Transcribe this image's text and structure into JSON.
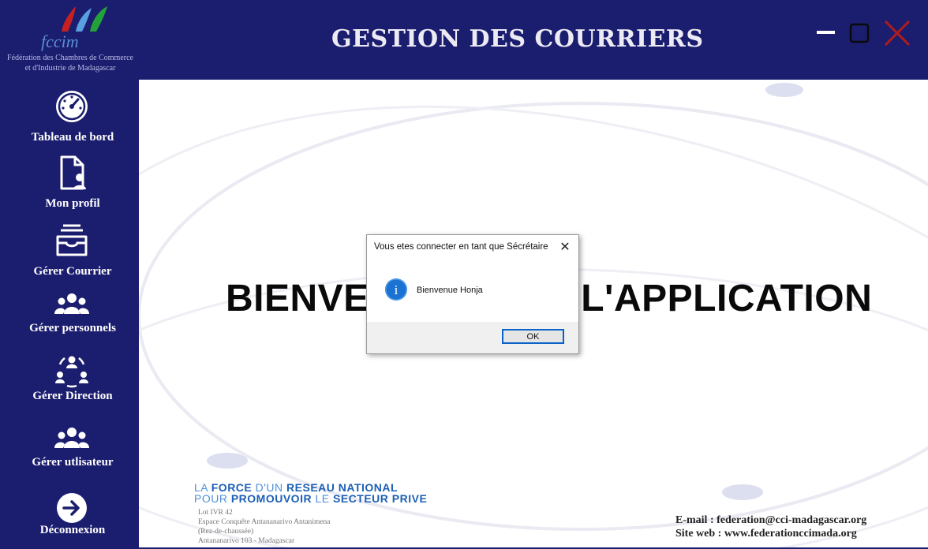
{
  "header": {
    "title": "GESTION DES COURRIERS",
    "logo_text": "fccim",
    "logo_caption_line1": "Fédération des Chambres de Commerce",
    "logo_caption_line2": "et d'Industrie de Madagascar"
  },
  "window_controls": {
    "minimize_icon": "minimize-icon",
    "maximize_icon": "maximize-icon",
    "close_icon": "close-icon",
    "close_color": "#b01c1c"
  },
  "sidebar": {
    "items": [
      {
        "label": "Tableau de bord",
        "icon": "dashboard-gauge-icon"
      },
      {
        "label": "Mon profil",
        "icon": "profile-document-icon"
      },
      {
        "label": "Gérer Courrier",
        "icon": "inbox-tray-icon"
      },
      {
        "label": "Gérer personnels",
        "icon": "group-users-icon"
      },
      {
        "label": "Gérer Direction",
        "icon": "direction-network-icon"
      },
      {
        "label": "Gérer utlisateur",
        "icon": "users-icon"
      },
      {
        "label": "Déconnexion",
        "icon": "logout-arrow-icon"
      }
    ]
  },
  "main": {
    "welcome_text": "BIENVENUE DANS L'APPLICATION",
    "slogan_line1": [
      "LA ",
      "FORCE",
      " D'UN ",
      "RESEAU NATIONAL"
    ],
    "slogan_line2": [
      "POUR ",
      "PROMOUVOIR",
      " LE ",
      "SECTEUR PRIVE"
    ],
    "address": [
      "Lot IVR 42",
      "Espace Conquête Antananarivo Antanimena",
      "(Rez-de-chaussée)",
      "Antananarivo 103 - Madagascar"
    ],
    "email": "E-mail : federation@cci-madagascar.org",
    "website": "Site web : www.federationccimada.org"
  },
  "dialog": {
    "title": "Vous etes connecter en tant que Sécrétaire",
    "message": "Bienvenue Honja",
    "ok_label": "OK",
    "close_glyph": "✕",
    "info_glyph": "i"
  },
  "colors": {
    "primary": "#1b1d6e",
    "slogan_blue": "#1b5fb5",
    "dialog_accent": "#0a64c8"
  }
}
